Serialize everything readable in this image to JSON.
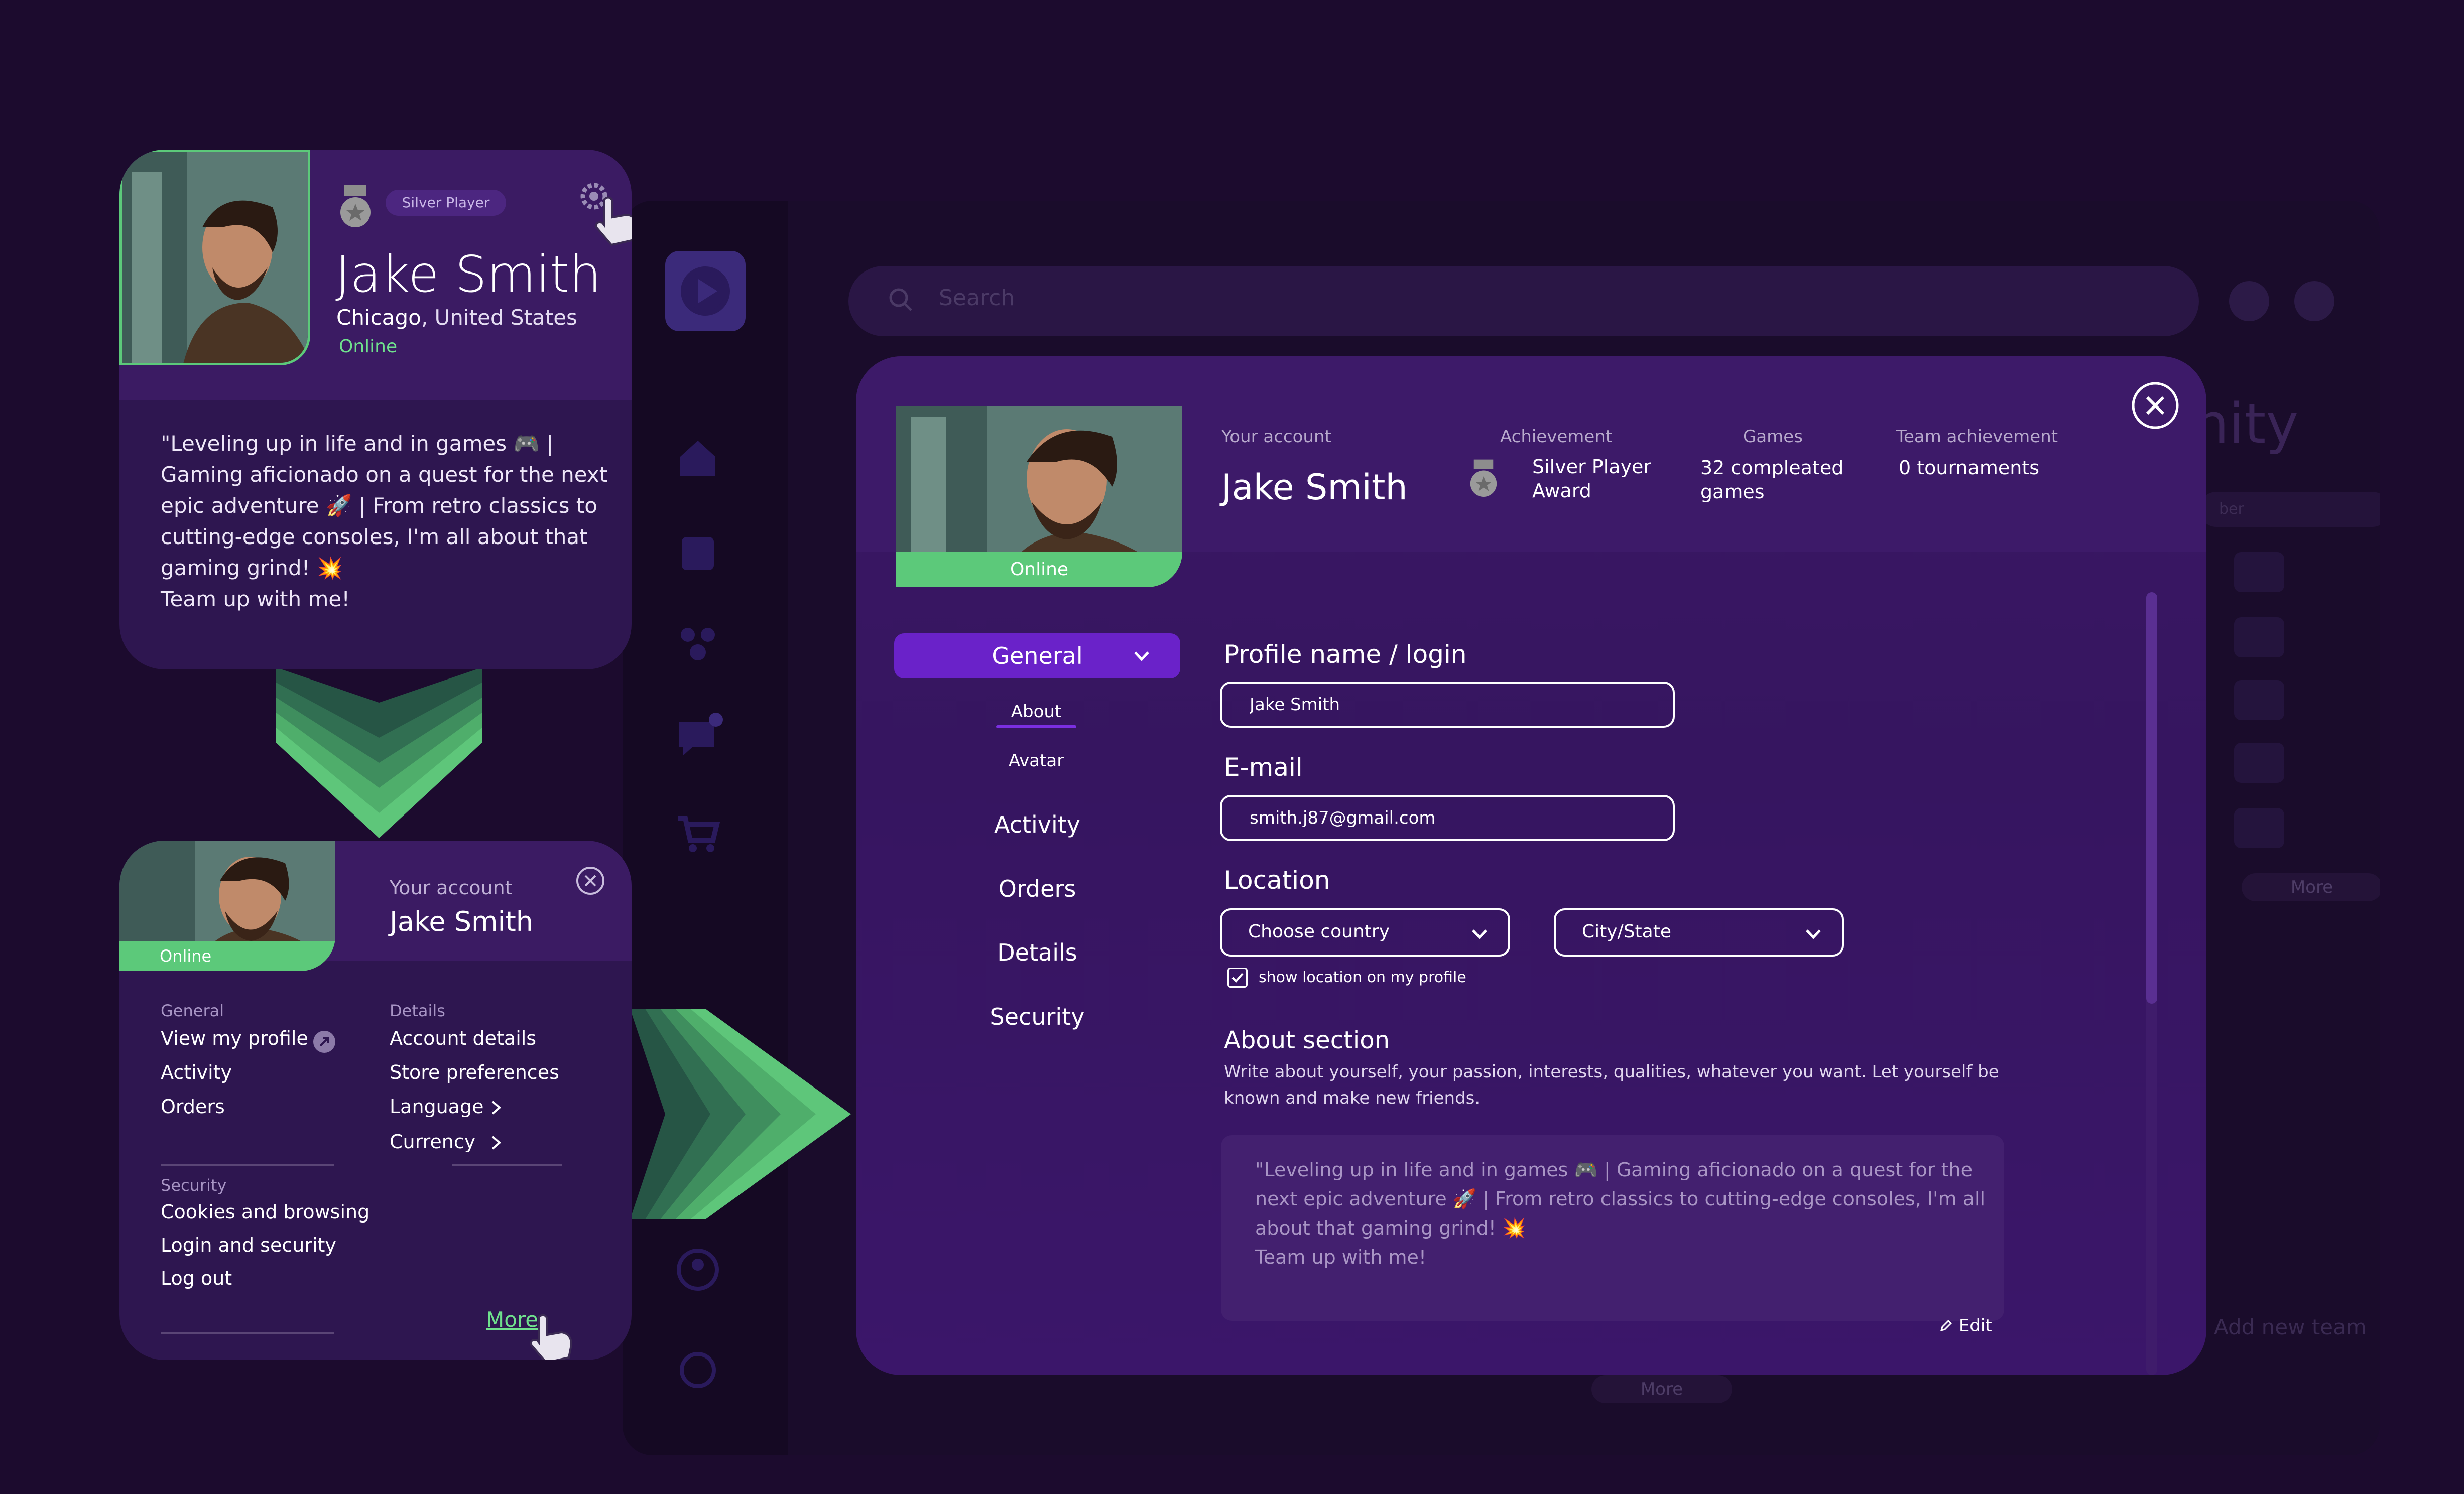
{
  "background_app": {
    "search_placeholder": "Search",
    "heading_fragment": "nity",
    "search_fragment": "ber",
    "more_label": "More",
    "add_team_label": "Add new team",
    "bottom_more_label": "More",
    "notification_count": "1"
  },
  "profile_card": {
    "badge": "Silver Player",
    "name": "Jake Smith",
    "city": "Chicago",
    "country": ", United States",
    "status": "Online",
    "bio_lines": [
      "\"Leveling up in life and in games 🎮 |",
      "Gaming aficionado on a quest for the next",
      "epic adventure 🚀 | From retro classics to",
      "cutting-edge consoles, I'm all about that",
      "gaming grind! 💥",
      "Team up with me!"
    ]
  },
  "account_menu": {
    "status": "Online",
    "label": "Your account",
    "name": "Jake Smith",
    "general_heading": "General",
    "general_items": [
      "View my profile",
      "Activity",
      "Orders"
    ],
    "details_heading": "Details",
    "details_items": [
      "Account details",
      "Store preferences",
      "Language",
      "Currency"
    ],
    "security_heading": "Security",
    "security_items": [
      "Cookies and browsing",
      "Login and security",
      "Log out"
    ],
    "more_label": "More"
  },
  "modal": {
    "photo_status": "Online",
    "account_label": "Your account",
    "account_name": "Jake Smith",
    "achievement_label": "Achievement",
    "achievement_value_lines": [
      "Silver Player",
      "Award"
    ],
    "games_label": "Games",
    "games_value_lines": [
      "32 compleated",
      "games"
    ],
    "team_label": "Team achievement",
    "team_value": "0 tournaments",
    "nav": {
      "general": "General",
      "about": "About",
      "avatar": "Avatar",
      "items": [
        "Activity",
        "Orders",
        "Details",
        "Security"
      ]
    },
    "form": {
      "profile_label": "Profile name / login",
      "profile_value": "Jake Smith",
      "email_label": "E-mail",
      "email_value": "smith.j87@gmail.com",
      "location_label": "Location",
      "country_placeholder": "Choose country",
      "city_placeholder": "City/State",
      "show_location_label": "show location on my profile",
      "show_location_checked": true,
      "about_heading": "About section",
      "about_desc_lines": [
        "Write about yourself, your passion, interests, qualities, whatever you want. Let yourself be",
        "known and make new friends."
      ],
      "about_text_lines": [
        "\"Leveling up in life and in games 🎮 | Gaming aficionado on a quest for the",
        "next epic adventure 🚀 | From retro classics to cutting-edge consoles, I'm all",
        "about that gaming grind! 💥",
        "Team up with me!"
      ],
      "edit_label": "Edit"
    }
  },
  "colors": {
    "page_bg": "#1c0b2e",
    "card_bg": "#2e1650",
    "accent_purple": "#6a22c9",
    "online_green": "#5cc97a",
    "silver": "#9a9a9a"
  }
}
